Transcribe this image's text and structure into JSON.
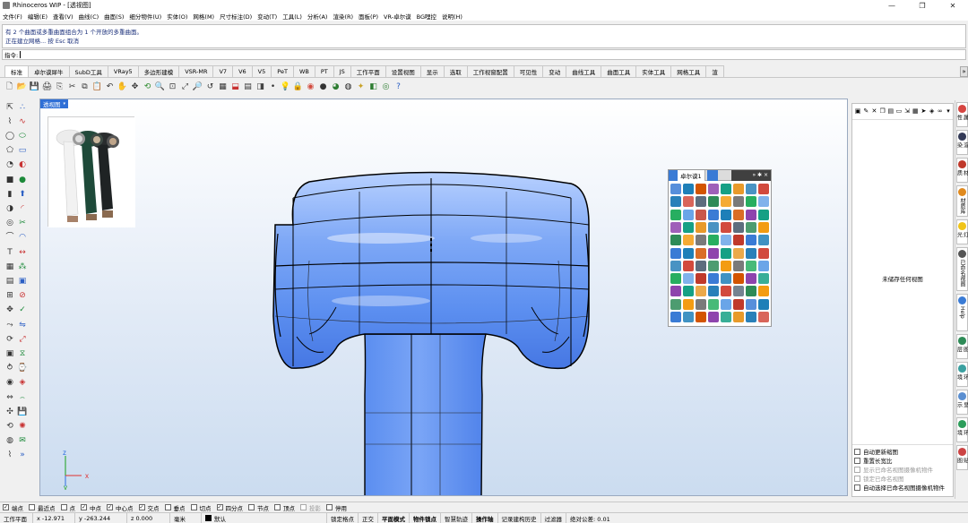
{
  "title": "Rhinoceros WIP - [透视图]",
  "window_buttons": [
    "—",
    "❐",
    "✕"
  ],
  "menu": [
    "文件(F)",
    "编辑(E)",
    "查看(V)",
    "曲线(C)",
    "曲面(S)",
    "细分物件(U)",
    "实体(O)",
    "网格(M)",
    "尺寸标注(D)",
    "变动(T)",
    "工具(L)",
    "分析(A)",
    "渲染(R)",
    "面板(P)",
    "VR-卓尔谟",
    "BG哩控",
    "说明(H)"
  ],
  "history": [
    "有 2 个曲面或多重曲面组合为 1 个开放的多重曲面。",
    "正在建立网格... 按 Esc 取消"
  ],
  "command": {
    "prompt": "指令:",
    "value": ""
  },
  "tabs": [
    "标准",
    "卓尔谟犀牛",
    "SubD工具",
    "VRay5",
    "多边形建模",
    "VSR-MR",
    "V7",
    "V6",
    "V5",
    "PeT",
    "WB",
    "PT",
    "JS",
    "工作平面",
    "设置视图",
    "显示",
    "选取",
    "工作视窗配置",
    "可见性",
    "变动",
    "曲线工具",
    "曲面工具",
    "实体工具",
    "网格工具",
    "渲"
  ],
  "tab_more": "»",
  "viewport": {
    "label": "透视图",
    "dropdown": "▾"
  },
  "axes": {
    "x": "x",
    "y": "y",
    "z": "z"
  },
  "float_panel": {
    "tab_label": "卓尔谟1",
    "ctrl": "» ✱ ×"
  },
  "right_panel": {
    "message": "未储存任何视图",
    "options": [
      {
        "label": "自动更新缩图",
        "checked": false,
        "disabled": false
      },
      {
        "label": "重置长宽比",
        "checked": false,
        "disabled": false
      },
      {
        "label": "显示已命名视图摄像机物件",
        "checked": false,
        "disabled": true
      },
      {
        "label": "锁定已命名视图",
        "checked": false,
        "disabled": true
      },
      {
        "label": "自动选择已命名视图摄像机物件",
        "checked": false,
        "disabled": false
      }
    ]
  },
  "side_tabs": [
    {
      "label": "属性",
      "color": "#d64541"
    },
    {
      "label": "渲染",
      "color": "#333a57"
    },
    {
      "label": "材质",
      "color": "#c0392b"
    },
    {
      "label": "材质库",
      "color": "#e08a1e"
    },
    {
      "label": "灯光",
      "color": "#f0c419"
    },
    {
      "label": "已命名视图",
      "color": "#555555"
    },
    {
      "label": "Help",
      "color": "#3a7bd5"
    },
    {
      "label": "图层",
      "color": "#2e8b57"
    },
    {
      "label": "环境",
      "color": "#3aa0a0"
    },
    {
      "label": "显示",
      "color": "#5b8fd1"
    },
    {
      "label": "环境",
      "color": "#2c9d5a"
    },
    {
      "label": "贴图",
      "color": "#c44"
    }
  ],
  "osnaps": [
    {
      "label": "端点",
      "checked": true,
      "disabled": false
    },
    {
      "label": "最近点",
      "checked": false,
      "disabled": false
    },
    {
      "label": "点",
      "checked": false,
      "disabled": false
    },
    {
      "label": "中点",
      "checked": true,
      "disabled": false
    },
    {
      "label": "中心点",
      "checked": true,
      "disabled": false
    },
    {
      "label": "交点",
      "checked": true,
      "disabled": false
    },
    {
      "label": "垂点",
      "checked": false,
      "disabled": false
    },
    {
      "label": "切点",
      "checked": false,
      "disabled": false
    },
    {
      "label": "四分点",
      "checked": true,
      "disabled": false
    },
    {
      "label": "节点",
      "checked": false,
      "disabled": false
    },
    {
      "label": "顶点",
      "checked": false,
      "disabled": false
    },
    {
      "label": "投影",
      "checked": false,
      "disabled": true
    },
    {
      "label": "停用",
      "checked": false,
      "disabled": false
    }
  ],
  "status": {
    "cplane": "工作平面",
    "x": "x -12.971",
    "y": "y -263.244",
    "z": "z 0.000",
    "units": "毫米",
    "layer": "默认",
    "toggles": [
      {
        "label": "锁定格点",
        "bold": false
      },
      {
        "label": "正交",
        "bold": false
      },
      {
        "label": "平面模式",
        "bold": true
      },
      {
        "label": "物件锁点",
        "bold": true
      },
      {
        "label": "智慧轨迹",
        "bold": false
      },
      {
        "label": "操作轴",
        "bold": true
      },
      {
        "label": "记录建构历史",
        "bold": false
      },
      {
        "label": "过滤器",
        "bold": false
      }
    ],
    "tolerance": "绝对公差: 0.01"
  },
  "toolbar_icons": [
    "new-icon",
    "open-icon",
    "save-icon",
    "print-icon",
    "import-icon",
    "cut-icon",
    "copy-icon",
    "paste-icon",
    "undo-icon",
    "pan-hand-icon",
    "move-icon",
    "rotate-view-icon",
    "zoom-icon",
    "zoom-window-icon",
    "zoom-extents-icon",
    "zoom-selected-icon",
    "undo-view-icon",
    "viewport-layout-icon",
    "construction-plane-icon",
    "grid-icon",
    "set-view-icon",
    "point-icon",
    "hide-icon",
    "lock-icon",
    "color-wheel-icon",
    "display-sphere-icon",
    "shaded-sphere-icon",
    "rendered-sphere-icon",
    "light-icon",
    "render-icon",
    "properties-icon",
    "help-icon"
  ]
}
